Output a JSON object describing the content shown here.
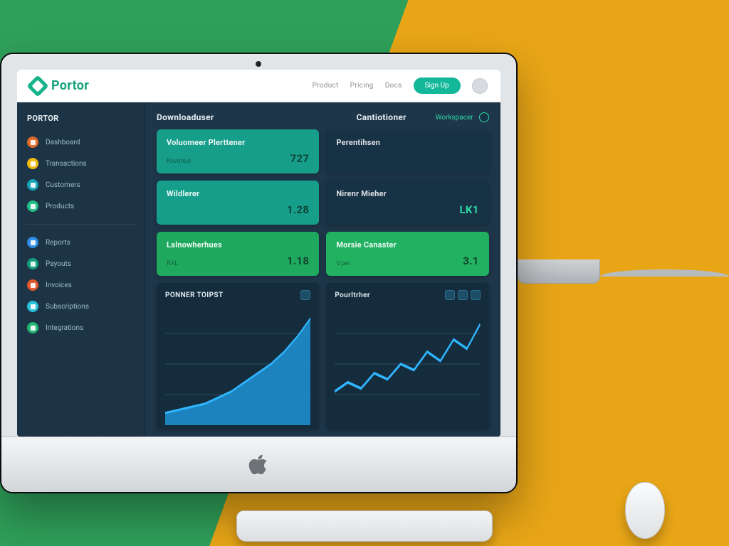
{
  "brand": {
    "name": "Portor"
  },
  "topnav": {
    "links": [
      "Product",
      "Pricing",
      "Docs"
    ],
    "cta": "Sign Up"
  },
  "sidebar": {
    "title": "PORTOR",
    "groups": [
      [
        {
          "label": "Dashboard",
          "color": "#e06a2b"
        },
        {
          "label": "Transactions",
          "color": "#f0b90e"
        },
        {
          "label": "Customers",
          "color": "#17a2b8"
        },
        {
          "label": "Products",
          "color": "#1fbf85"
        }
      ],
      [
        {
          "label": "Reports",
          "color": "#2f8de4"
        },
        {
          "label": "Payouts",
          "color": "#139e7c"
        },
        {
          "label": "Invoices",
          "color": "#e0582b"
        },
        {
          "label": "Subscriptions",
          "color": "#28c0d8"
        },
        {
          "label": "Integrations",
          "color": "#21b573"
        }
      ]
    ]
  },
  "columns": {
    "left": "Downloaduser",
    "right": "Cantiotioner",
    "meta": "Workspacer"
  },
  "cards": [
    {
      "label": "Voluomeer Plerttener",
      "sub": "Revenue",
      "value": "727",
      "cls": "teal"
    },
    {
      "label": "Perentihsen",
      "sub": "",
      "value": "",
      "cls": "dark"
    },
    {
      "label": "Wildlerer",
      "sub": "",
      "value": "1.28",
      "cls": "teal2"
    },
    {
      "label": "Nirenr Mieher",
      "sub": "",
      "value": "LK1",
      "cls": "dark"
    },
    {
      "label": "Lalnowherhues",
      "sub": "RAL",
      "value": "1.18",
      "cls": "green"
    },
    {
      "label": "Morsie Canaster",
      "sub": "V.per",
      "value": "3.1",
      "cls": "green2"
    }
  ],
  "chart_data": [
    {
      "type": "area",
      "title": "PONNER TOIPST",
      "x": [
        0,
        1,
        2,
        3,
        4,
        5,
        6,
        7,
        8,
        9,
        10,
        11
      ],
      "values": [
        8,
        10,
        12,
        14,
        18,
        22,
        28,
        34,
        40,
        48,
        58,
        70
      ],
      "ylim": [
        0,
        80
      ],
      "grid": true
    },
    {
      "type": "line",
      "title": "Pourltrher",
      "x": [
        0,
        1,
        2,
        3,
        4,
        5,
        6,
        7,
        8,
        9,
        10,
        11
      ],
      "values": [
        22,
        28,
        24,
        34,
        30,
        40,
        36,
        48,
        42,
        56,
        50,
        66
      ],
      "ylim": [
        0,
        80
      ],
      "grid": true,
      "chips": 3
    }
  ]
}
